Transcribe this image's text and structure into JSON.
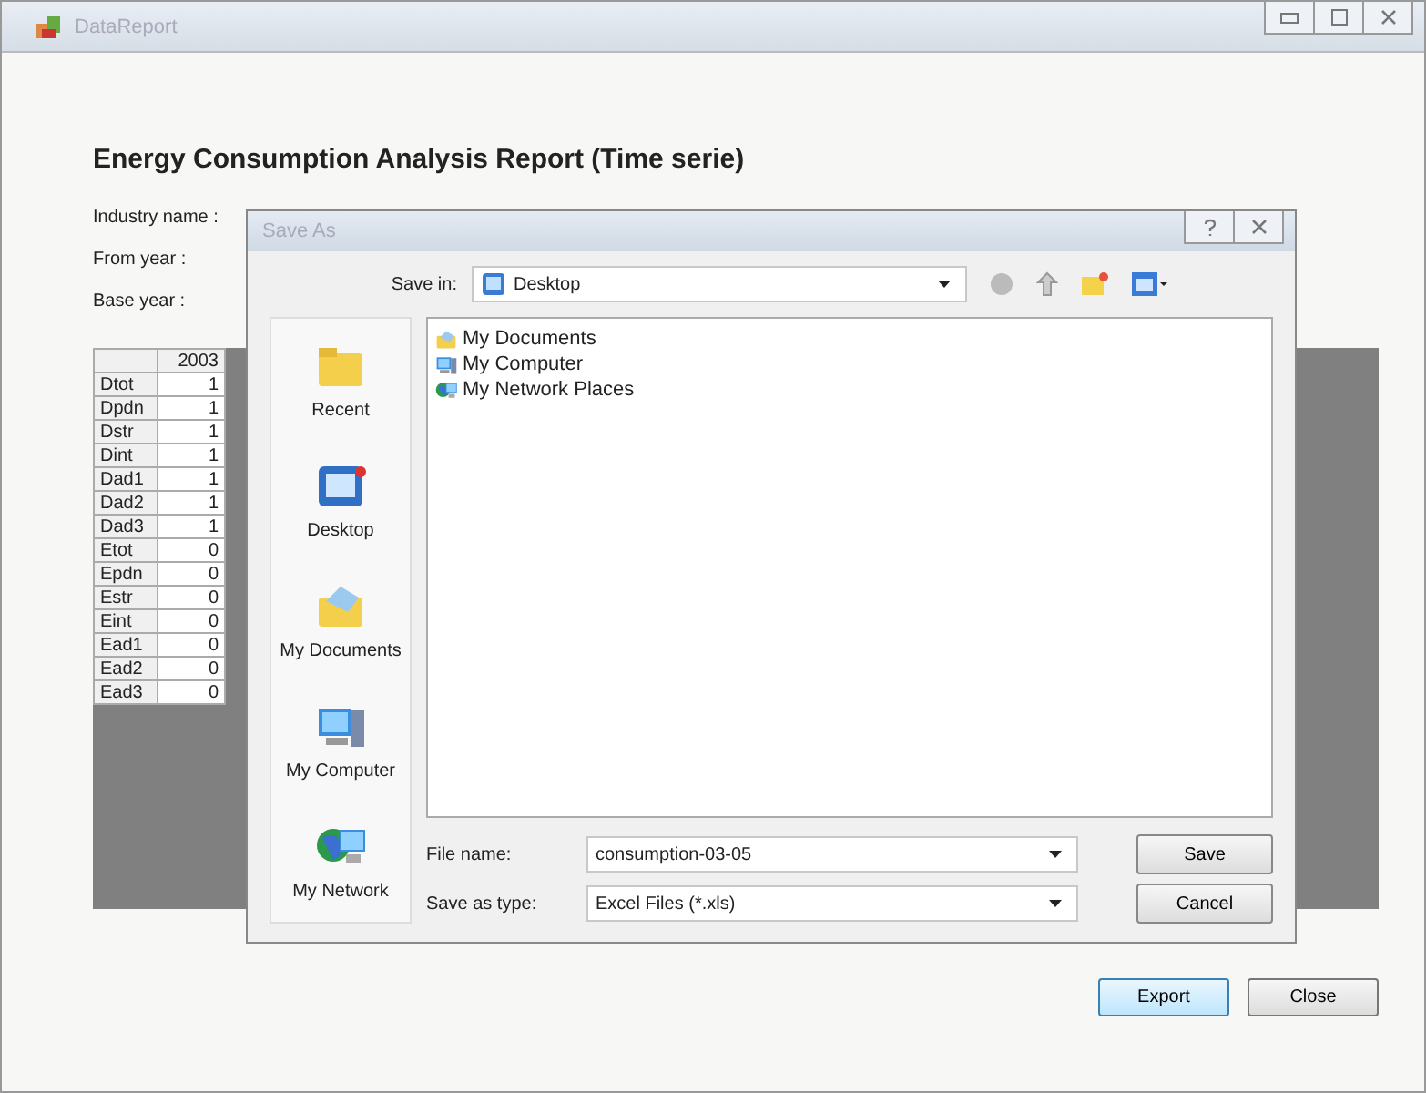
{
  "window": {
    "title": "DataReport"
  },
  "report": {
    "heading": "Energy Consumption Analysis Report (Time serie)",
    "fields": [
      {
        "label": "Industry name :"
      },
      {
        "label": "From year :"
      },
      {
        "label": "Base year :"
      }
    ]
  },
  "table": {
    "columns": [
      "2003"
    ],
    "rows": [
      {
        "name": "Dtot",
        "values": [
          "1"
        ]
      },
      {
        "name": "Dpdn",
        "values": [
          "1"
        ]
      },
      {
        "name": "Dstr",
        "values": [
          "1"
        ]
      },
      {
        "name": "Dint",
        "values": [
          "1"
        ]
      },
      {
        "name": "Dad1",
        "values": [
          "1"
        ]
      },
      {
        "name": "Dad2",
        "values": [
          "1"
        ]
      },
      {
        "name": "Dad3",
        "values": [
          "1"
        ]
      },
      {
        "name": "Etot",
        "values": [
          "0"
        ]
      },
      {
        "name": "Epdn",
        "values": [
          "0"
        ]
      },
      {
        "name": "Estr",
        "values": [
          "0"
        ]
      },
      {
        "name": "Eint",
        "values": [
          "0"
        ]
      },
      {
        "name": "Ead1",
        "values": [
          "0"
        ]
      },
      {
        "name": "Ead2",
        "values": [
          "0"
        ]
      },
      {
        "name": "Ead3",
        "values": [
          "0"
        ]
      }
    ]
  },
  "buttons": [
    {
      "label": "Export",
      "selected": true
    },
    {
      "label": "Close",
      "selected": false
    }
  ],
  "dialog": {
    "title": "Save As",
    "save_in_label": "Save in:",
    "save_in_value": "Desktop",
    "places": [
      {
        "label": "Recent",
        "kind": "recent"
      },
      {
        "label": "Desktop",
        "kind": "desktop"
      },
      {
        "label": "My Documents",
        "kind": "documents"
      },
      {
        "label": "My Computer",
        "kind": "computer"
      },
      {
        "label": "My Network",
        "kind": "network"
      }
    ],
    "files": [
      {
        "label": "My Documents",
        "kind": "documents"
      },
      {
        "label": "My Computer",
        "kind": "computer"
      },
      {
        "label": "My Network Places",
        "kind": "network"
      }
    ],
    "file_name_label": "File name:",
    "file_name": "consumption-03-05",
    "type_label": "Save as type:",
    "type_value": "Excel Files (*.xls)",
    "buttons": [
      {
        "label": "Save"
      },
      {
        "label": "Cancel"
      }
    ]
  }
}
